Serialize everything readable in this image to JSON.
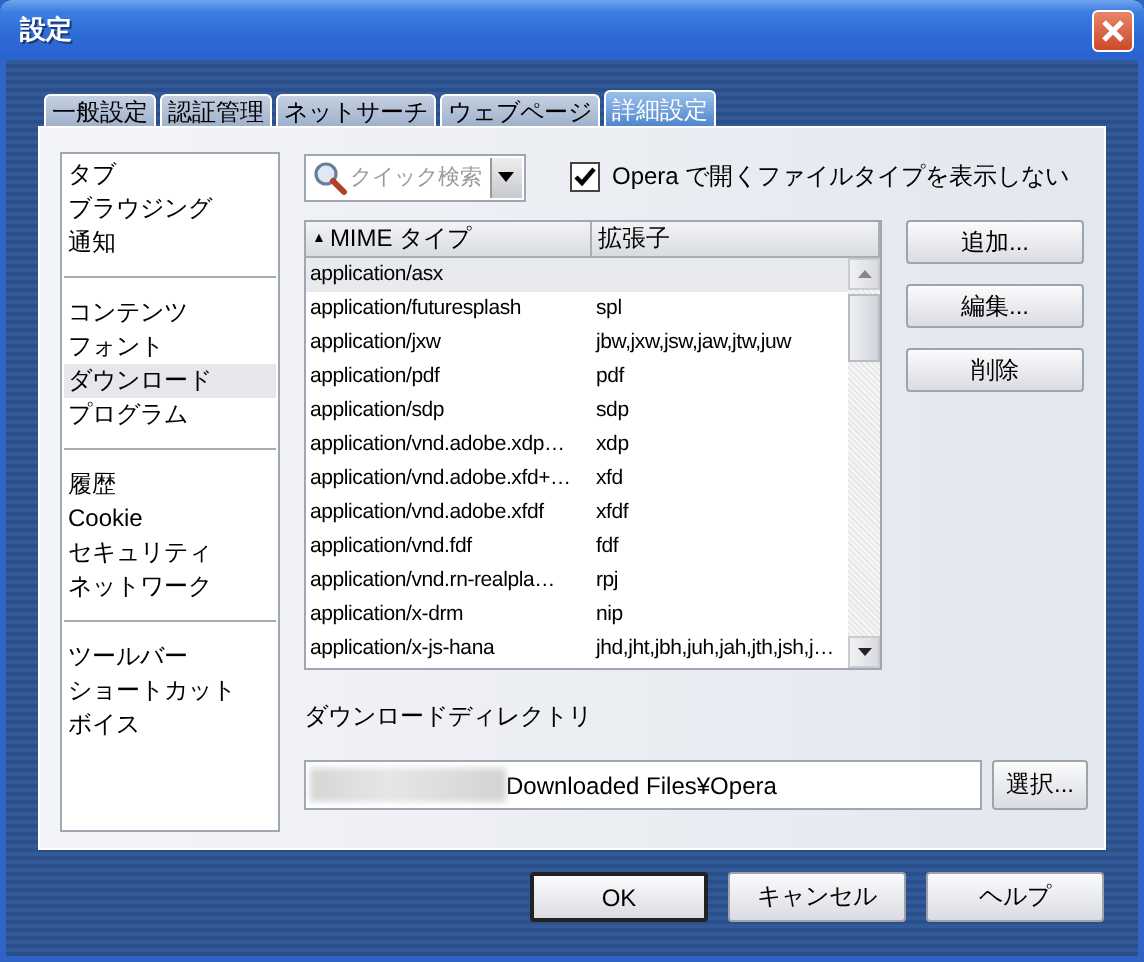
{
  "window": {
    "title": "設定"
  },
  "tabs": [
    {
      "label": "一般設定",
      "selected": false
    },
    {
      "label": "認証管理",
      "selected": false
    },
    {
      "label": "ネットサーチ",
      "selected": false
    },
    {
      "label": "ウェブページ",
      "selected": false
    },
    {
      "label": "詳細設定",
      "selected": true
    }
  ],
  "sidebar": {
    "groups": [
      [
        {
          "label": "タブ",
          "selected": false
        },
        {
          "label": "ブラウジング",
          "selected": false
        },
        {
          "label": "通知",
          "selected": false
        }
      ],
      [
        {
          "label": "コンテンツ",
          "selected": false
        },
        {
          "label": "フォント",
          "selected": false
        },
        {
          "label": "ダウンロード",
          "selected": true
        },
        {
          "label": "プログラム",
          "selected": false
        }
      ],
      [
        {
          "label": "履歴",
          "selected": false
        },
        {
          "label": "Cookie",
          "selected": false
        },
        {
          "label": "セキュリティ",
          "selected": false
        },
        {
          "label": "ネットワーク",
          "selected": false
        }
      ],
      [
        {
          "label": "ツールバー",
          "selected": false
        },
        {
          "label": "ショートカット",
          "selected": false
        },
        {
          "label": "ボイス",
          "selected": false
        }
      ]
    ]
  },
  "search": {
    "placeholder": "クイック検索"
  },
  "hide_opera_types": {
    "label": "Opera で開くファイルタイプを表示しない",
    "checked": true
  },
  "table": {
    "columns": [
      "MIME タイプ",
      "拡張子"
    ],
    "sort_mark": "▲",
    "rows": [
      {
        "mime": "application/asx",
        "ext": "",
        "selected": true
      },
      {
        "mime": "application/futuresplash",
        "ext": "spl",
        "selected": false
      },
      {
        "mime": "application/jxw",
        "ext": "jbw,jxw,jsw,jaw,jtw,juw",
        "selected": false
      },
      {
        "mime": "application/pdf",
        "ext": "pdf",
        "selected": false
      },
      {
        "mime": "application/sdp",
        "ext": "sdp",
        "selected": false
      },
      {
        "mime": "application/vnd.adobe.xdp…",
        "ext": "xdp",
        "selected": false
      },
      {
        "mime": "application/vnd.adobe.xfd+…",
        "ext": "xfd",
        "selected": false
      },
      {
        "mime": "application/vnd.adobe.xfdf",
        "ext": "xfdf",
        "selected": false
      },
      {
        "mime": "application/vnd.fdf",
        "ext": "fdf",
        "selected": false
      },
      {
        "mime": "application/vnd.rn-realpla…",
        "ext": "rpj",
        "selected": false
      },
      {
        "mime": "application/x-drm",
        "ext": "nip",
        "selected": false
      },
      {
        "mime": "application/x-js-hana",
        "ext": "jhd,jht,jbh,juh,jah,jth,jsh,j…",
        "selected": false
      }
    ]
  },
  "side_buttons": [
    "追加...",
    "編集...",
    "削除"
  ],
  "download_directory": {
    "label": "ダウンロードディレクトリ",
    "value": "Downloaded Files¥Opera",
    "button": "選択..."
  },
  "buttons": [
    {
      "label": "OK",
      "default": true
    },
    {
      "label": "キャンセル",
      "default": false
    },
    {
      "label": "ヘルプ",
      "default": false
    }
  ]
}
